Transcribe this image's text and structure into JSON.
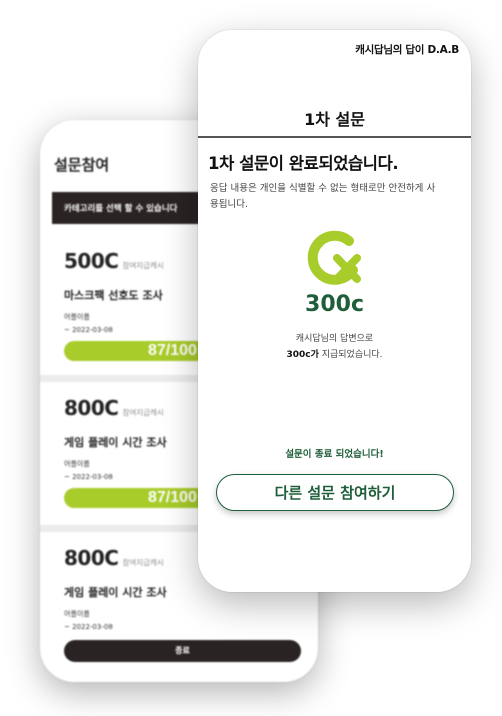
{
  "back_screen": {
    "title": "설문참여",
    "banner": "카테고리를 선택 할 수 있습니다",
    "surveys": [
      {
        "price": "500C",
        "pay_label": "참여지급캐시",
        "name": "마스크팩 선호도 조사",
        "company": "어플이름",
        "date": "~ 2022-03-08",
        "progress": 87,
        "progress_label": "87/100"
      },
      {
        "price": "800C",
        "pay_label": "참여지급캐시",
        "name": "게임 플레이 시간 조사",
        "company": "어플이름",
        "date": "~ 2022-03-08",
        "progress": 87,
        "progress_label": "87/100"
      },
      {
        "price": "800C",
        "pay_label": "참여지급캐시",
        "name": "게임 플레이 시간 조사",
        "company": "어플이름",
        "date": "~ 2022-03-08",
        "status_button": "종료"
      }
    ]
  },
  "front_screen": {
    "brand": "캐시답님의 답이 D.A.B",
    "header_title": "1차 설문",
    "heading": "1차 설문이 완료되었습니다.",
    "description": "응답 내용은 개인을 식별할 수 없는 형태로만 안전하게 사용됩니다.",
    "logo_icon": "cash-c-logo-icon",
    "reward_amount": "300c",
    "reward_note_line1": "캐시답님의 답변으로",
    "reward_note_amount": "300c가",
    "reward_note_line2": " 지급되었습니다.",
    "done_message": "설문이 종료 되었습니다!",
    "cta_button": "다른 설문 참여하기"
  },
  "colors": {
    "brand_green": "#1f5e3a",
    "lime_accent": "#a8cc2a",
    "dark_banner": "#2a2323"
  }
}
